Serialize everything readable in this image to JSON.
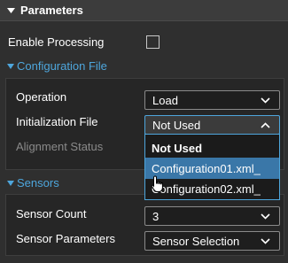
{
  "panel": {
    "title": "Parameters",
    "enable_processing_label": "Enable Processing",
    "enable_processing_checked": false
  },
  "configuration": {
    "title": "Configuration File",
    "operation_label": "Operation",
    "operation_value": "Load",
    "init_file_label": "Initialization File",
    "init_file_value": "Not Used",
    "alignment_label": "Alignment Status",
    "dropdown_options": [
      "Not Used",
      "Configuration01.xml_",
      "Configuration02.xml_"
    ],
    "dropdown_selected": "Not Used",
    "dropdown_hovered": "Configuration01.xml_"
  },
  "sensors": {
    "title": "Sensors",
    "count_label": "Sensor Count",
    "count_value": "3",
    "params_label": "Sensor Parameters",
    "params_value": "Sensor Selection"
  },
  "colors": {
    "accent": "#4ea6dc",
    "highlight": "#3a77a8",
    "background": "#2f2f2f"
  },
  "icons": {
    "collapse": "triangle-down-icon",
    "chevron": "chevron-down-icon",
    "cursor": "hand-pointer-icon"
  }
}
